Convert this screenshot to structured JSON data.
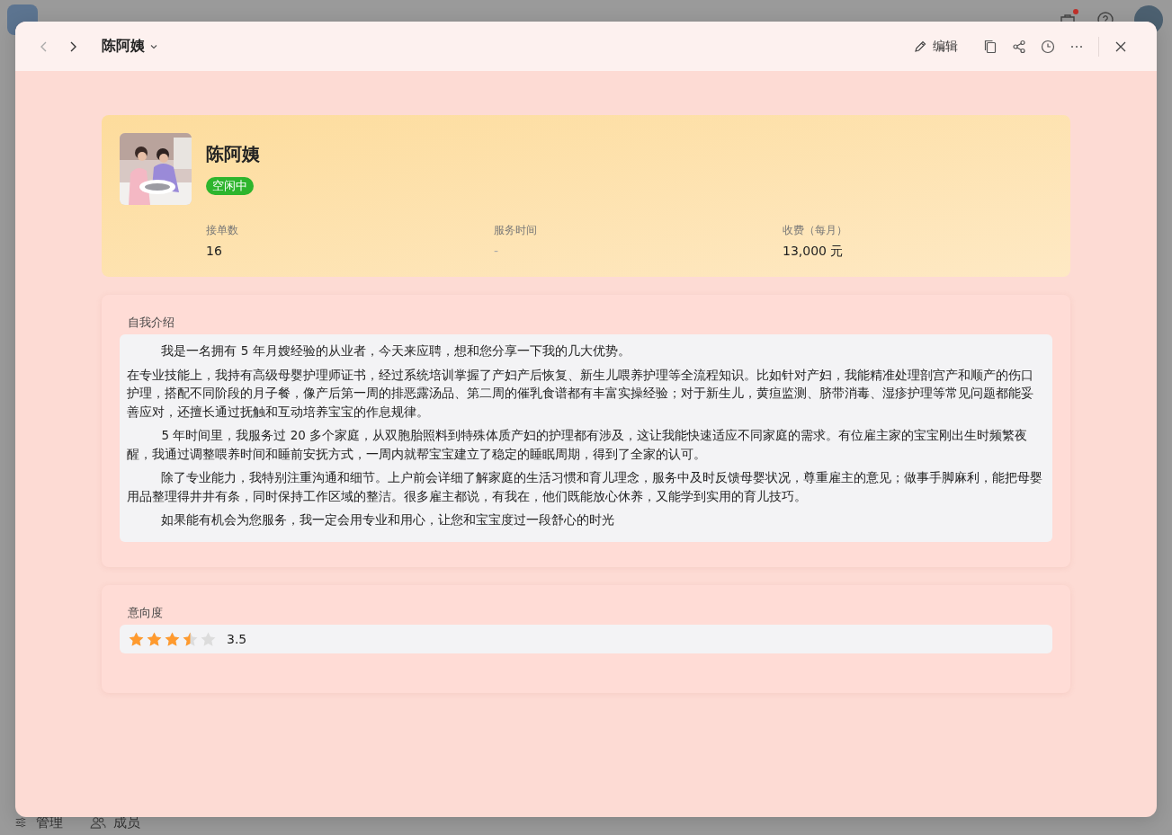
{
  "app": {
    "notification_dot": true,
    "footer": [
      {
        "kind": "manage",
        "label": "管理"
      },
      {
        "kind": "members",
        "label": "成员"
      }
    ]
  },
  "header": {
    "title": "陈阿姨",
    "edit_label": "编辑"
  },
  "profile": {
    "name": "陈阿姨",
    "status": "空闲中",
    "stats": [
      {
        "label": "接单数",
        "value": "16",
        "muted": false
      },
      {
        "label": "服务时间",
        "value": "-",
        "muted": true
      },
      {
        "label": "收费（每月）",
        "value": "13,000 元",
        "muted": false
      }
    ]
  },
  "intro": {
    "label": "自我介绍",
    "paragraphs": [
      {
        "text": "我是一名拥有 5 年月嫂经验的从业者，今天来应聘，想和您分享一下我的几大优势。",
        "indented": true
      },
      {
        "text": "在专业技能上，我持有高级母婴护理师证书，经过系统培训掌握了产妇产后恢复、新生儿喂养护理等全流程知识。比如针对产妇，我能精准处理剖宫产和顺产的伤口护理，搭配不同阶段的月子餐，像产后第一周的排恶露汤品、第二周的催乳食谱都有丰富实操经验；对于新生儿，黄疸监测、脐带消毒、湿疹护理等常见问题都能妥善应对，还擅长通过抚触和互动培养宝宝的作息规律。",
        "indented": false
      },
      {
        "text": "5 年时间里，我服务过 20 多个家庭，从双胞胎照料到特殊体质产妇的护理都有涉及，这让我能快速适应不同家庭的需求。有位雇主家的宝宝刚出生时频繁夜醒，我通过调整喂养时间和睡前安抚方式，一周内就帮宝宝建立了稳定的睡眠周期，得到了全家的认可。",
        "indented": true
      },
      {
        "text": "除了专业能力，我特别注重沟通和细节。上户前会详细了解家庭的生活习惯和育儿理念，服务中及时反馈母婴状况，尊重雇主的意见；做事手脚麻利，能把母婴用品整理得井井有条，同时保持工作区域的整洁。很多雇主都说，有我在，他们既能放心休养，又能学到实用的育儿技巧。",
        "indented": true
      },
      {
        "text": "如果能有机会为您服务，我一定会用专业和用心，让您和宝宝度过一段舒心的时光",
        "indented": true
      }
    ]
  },
  "rating": {
    "label": "意向度",
    "stars": 3.5,
    "reading": "3.5"
  }
}
